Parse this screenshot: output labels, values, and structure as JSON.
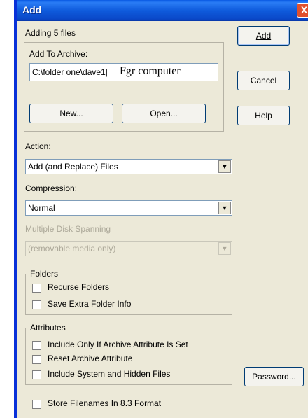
{
  "window": {
    "title": "Add",
    "close_glyph": "X"
  },
  "status": {
    "adding": "Adding 5 files"
  },
  "buttons": {
    "add": "Add",
    "cancel": "Cancel",
    "help": "Help",
    "new": "New...",
    "open": "Open...",
    "password": "Password..."
  },
  "archive": {
    "label": "Add To Archive:",
    "path": "C:\\folder one\\dave1|",
    "overlay_text": "Fgr computer"
  },
  "action": {
    "label": "Action:",
    "value": "Add (and Replace) Files"
  },
  "compression": {
    "label": "Compression:",
    "value": "Normal"
  },
  "spanning": {
    "label": "Multiple Disk Spanning",
    "value": "(removable media only)"
  },
  "folders": {
    "legend": "Folders",
    "recurse": "Recurse Folders",
    "save_extra": "Save Extra Folder Info"
  },
  "attributes": {
    "legend": "Attributes",
    "include_only_archive": "Include Only If Archive Attribute Is Set",
    "reset_archive": "Reset Archive Attribute",
    "include_system_hidden": "Include System and Hidden Files"
  },
  "store83": {
    "label": "Store Filenames In 8.3 Format"
  },
  "icons": {
    "dropdown": "chevron-down-icon",
    "close": "close-icon"
  }
}
